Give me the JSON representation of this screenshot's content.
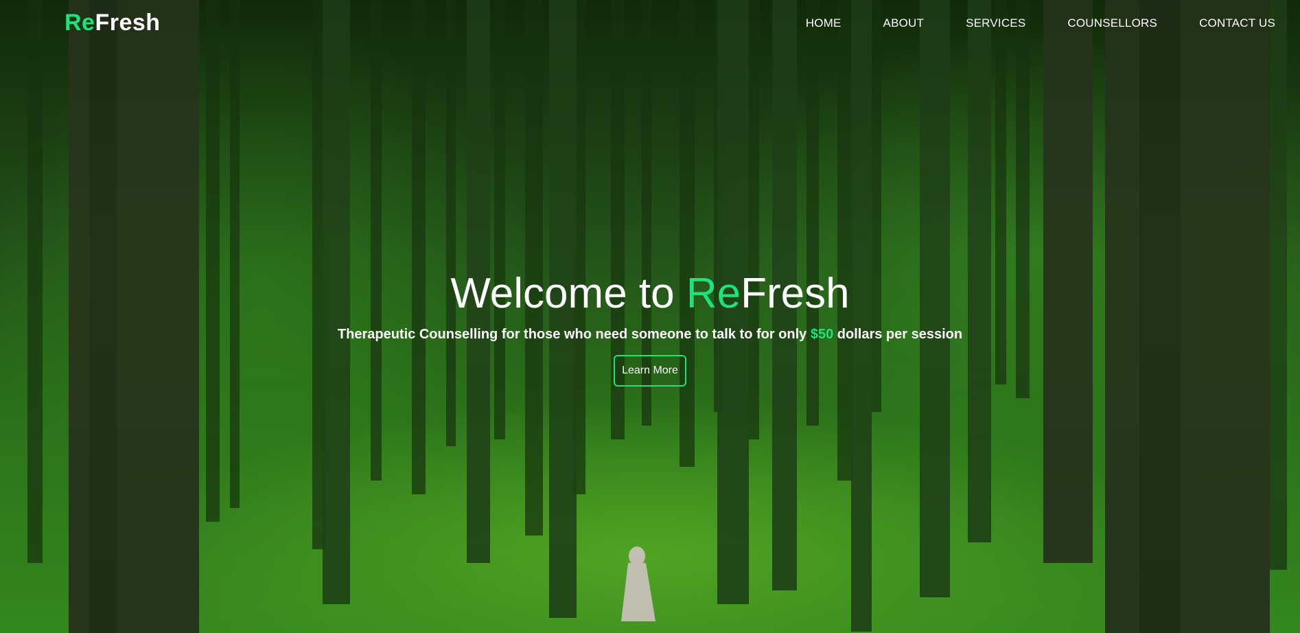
{
  "brand": {
    "prefix": "Re",
    "suffix": "Fresh",
    "accent_color": "#1de37c"
  },
  "nav": {
    "items": [
      {
        "label": "HOME"
      },
      {
        "label": "ABOUT"
      },
      {
        "label": "SERVICES"
      },
      {
        "label": "COUNSELLORS"
      },
      {
        "label": "CONTACT US"
      }
    ]
  },
  "hero": {
    "title_prefix": "Welcome to ",
    "title_accent": "Re",
    "title_suffix": "Fresh",
    "subtitle_before": "Therapeutic Counselling for those who need someone to talk to for only ",
    "subtitle_price": "$50",
    "subtitle_after": " dollars per session",
    "cta_label": "Learn More"
  },
  "background": {
    "scene": "forest-photo",
    "icon": "forest-background-image"
  }
}
